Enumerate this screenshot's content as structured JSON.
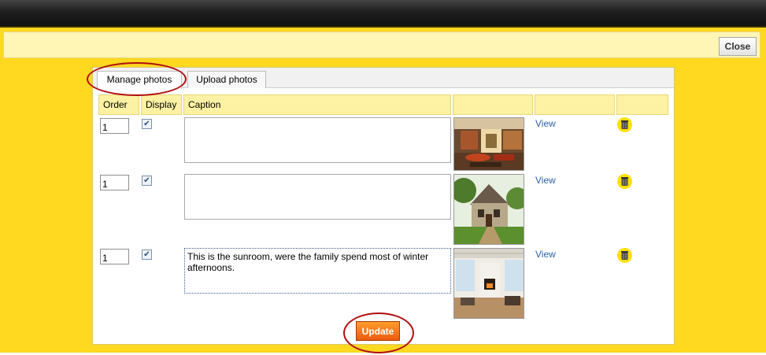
{
  "closebar": {
    "close_label": "Close"
  },
  "tabs": [
    {
      "label": "Manage photos",
      "active": true
    },
    {
      "label": "Upload photos",
      "active": false
    }
  ],
  "table": {
    "headers": [
      "Order",
      "Display",
      "Caption",
      "",
      "",
      ""
    ],
    "rows": [
      {
        "order": "1",
        "display": true,
        "caption": "",
        "photo": "living-room-photo",
        "view_label": "View",
        "delete_icon": "trash-icon"
      },
      {
        "order": "1",
        "display": true,
        "caption": "",
        "photo": "house-exterior-photo",
        "view_label": "View",
        "delete_icon": "trash-icon"
      },
      {
        "order": "1",
        "display": true,
        "caption": "This is the sunroom, were the family spend most of winter afternoons.",
        "photo": "sunroom-photo",
        "view_label": "View",
        "delete_icon": "trash-icon"
      }
    ]
  },
  "update_label": "Update",
  "colors": {
    "frame": "#ffd820",
    "header_cell": "#fdf2a3",
    "update_button": "#ee5a10",
    "link": "#2f5fa8",
    "annotation_ring": "#b01010"
  }
}
